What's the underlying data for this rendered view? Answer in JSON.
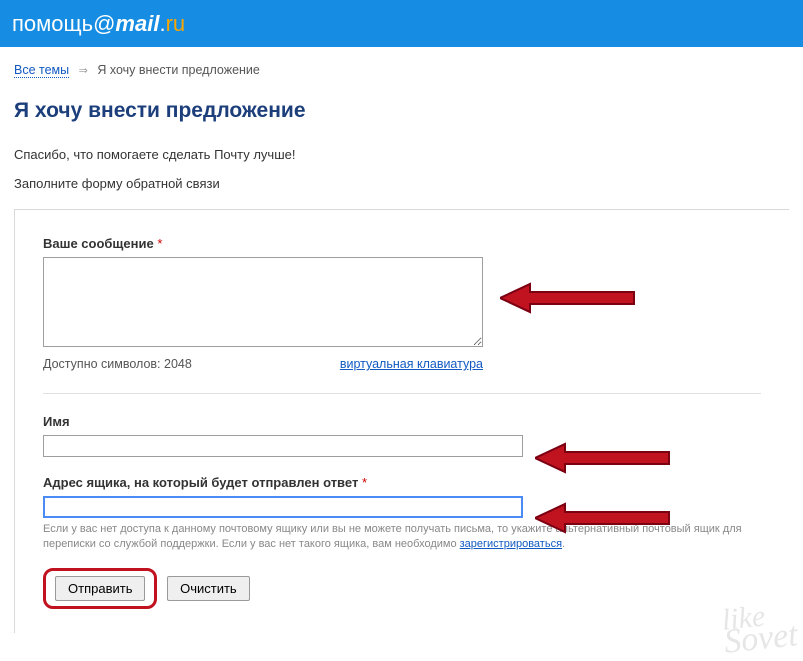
{
  "header": {
    "logo_prefix": "помощь",
    "logo_at": "@",
    "logo_mail": "mail",
    "logo_dot": ".",
    "logo_ru": "ru"
  },
  "breadcrumb": {
    "all_topics": "Все темы",
    "sep": "⇒",
    "current": "Я хочу внести предложение"
  },
  "page": {
    "title": "Я хочу внести предложение",
    "thanks": "Спасибо, что помогаете сделать Почту лучше!",
    "fill_form": "Заполните форму обратной связи"
  },
  "form": {
    "message_label": "Ваше сообщение",
    "required_mark": "*",
    "chars_available_prefix": "Доступно символов: ",
    "chars_available_count": "2048",
    "virtual_keyboard": "виртуальная клавиатура",
    "name_label": "Имя",
    "email_label": "Адрес ящика, на который будет отправлен ответ",
    "hint_text_1": "Если у вас нет доступа к данному почтовому ящику или вы не можете получать письма, то укажите альтернативный почтовый ящик для переписки со службой поддержки. Если у вас нет такого ящика, вам необходимо ",
    "hint_register": "зарегистрироваться",
    "hint_text_2": ".",
    "submit": "Отправить",
    "clear": "Очистить"
  },
  "watermark": {
    "l1": "like",
    "l2": "Sovet"
  }
}
